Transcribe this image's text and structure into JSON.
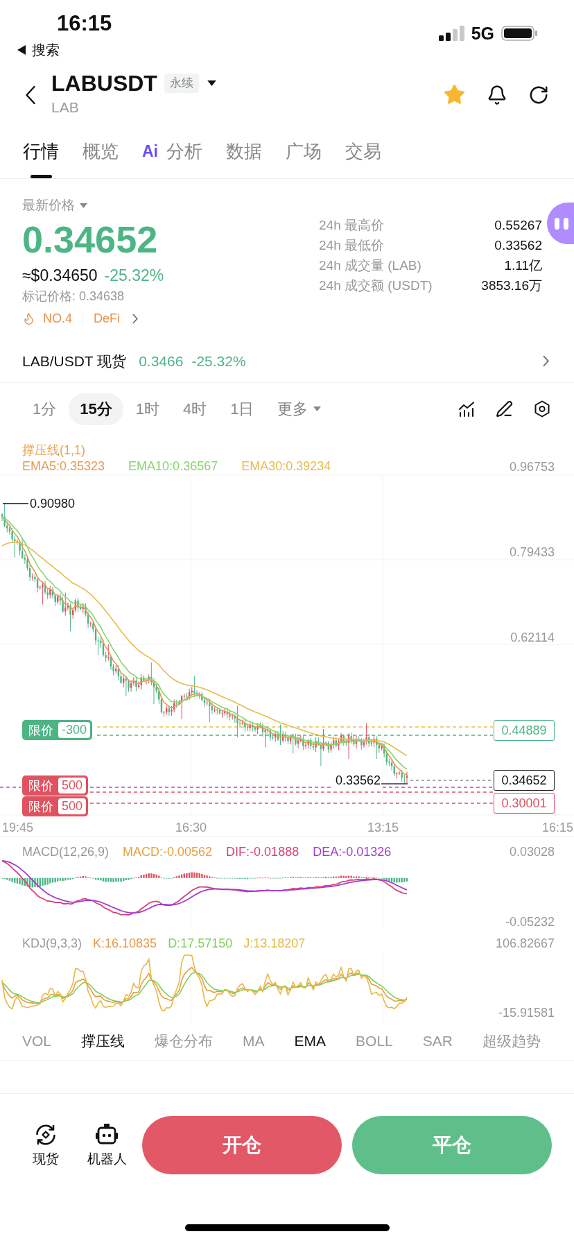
{
  "status_bar": {
    "time": "16:15",
    "back_app": "搜索",
    "network": "5G"
  },
  "header": {
    "symbol": "LABUSDT",
    "badge": "永续",
    "subtitle": "LAB",
    "favorite": true
  },
  "tabs": [
    {
      "label": "行情",
      "selected": true
    },
    {
      "label": "概览",
      "selected": false
    },
    {
      "label": "分析",
      "prefix": "Ai",
      "selected": false
    },
    {
      "label": "数据",
      "selected": false
    },
    {
      "label": "广场",
      "selected": false
    },
    {
      "label": "交易",
      "selected": false
    }
  ],
  "price": {
    "label": "最新价格",
    "last": "0.34652",
    "usd": "≈$0.34650",
    "change": "-25.32%",
    "mark_price": "标记价格: 0.34638",
    "rank": "NO.4",
    "sector": "DeFi"
  },
  "stats": [
    {
      "label": "24h 最高价",
      "value": "0.55267"
    },
    {
      "label": "24h 最低价",
      "value": "0.33562"
    },
    {
      "label": "24h 成交量 (LAB)",
      "value": "1.11亿"
    },
    {
      "label": "24h 成交额 (USDT)",
      "value": "3853.16万"
    }
  ],
  "spot": {
    "pair": "LAB/USDT 现货",
    "price": "0.3466",
    "change": "-25.32%"
  },
  "intervals": [
    {
      "label": "1分",
      "kind": "option",
      "selected": false
    },
    {
      "label": "15分",
      "kind": "option",
      "selected": true
    },
    {
      "label": "1时",
      "kind": "option",
      "selected": false
    },
    {
      "label": "4时",
      "kind": "option",
      "selected": false
    },
    {
      "label": "1日",
      "kind": "option",
      "selected": false
    },
    {
      "label": "更多",
      "kind": "menu",
      "selected": false
    }
  ],
  "chart": {
    "legend_title": "撑压线(1,1)",
    "ema": [
      {
        "label": "EMA5:0.35323",
        "color": "#e59a52"
      },
      {
        "label": "EMA10:0.36567",
        "color": "#86d66c"
      },
      {
        "label": "EMA30:0.39234",
        "color": "#e8bb4c"
      }
    ],
    "y_labels": [
      "0.96753",
      "0.79433",
      "0.62114"
    ],
    "high_label": "0.90980",
    "low_label": "0.33562",
    "orders": [
      {
        "type": "限价",
        "qty": "-300",
        "kind": "buy"
      },
      {
        "type": "限价",
        "qty": "500",
        "kind": "sell"
      },
      {
        "type": "限价",
        "qty": "500",
        "kind": "sell"
      }
    ],
    "price_tags": [
      {
        "value": "0.44889",
        "kind": "order_buy"
      },
      {
        "value": "0.34652",
        "kind": "last"
      },
      {
        "value": "0.30001",
        "kind": "order_sell"
      }
    ],
    "x_labels": [
      "19:45",
      "16:30",
      "13:15",
      "16:15"
    ]
  },
  "macd": {
    "title": "MACD(12,26,9)",
    "values": [
      {
        "label": "MACD:-0.00562",
        "color": "#e8a040"
      },
      {
        "label": "DIF:-0.01888",
        "color": "#d8407a"
      },
      {
        "label": "DEA:-0.01326",
        "color": "#a03ed0"
      }
    ],
    "max": "0.03028",
    "min": "-0.05232"
  },
  "kdj": {
    "title": "KDJ(9,3,3)",
    "values": [
      {
        "label": "K:16.10835",
        "color": "#e89a4a"
      },
      {
        "label": "D:17.57150",
        "color": "#7dd058"
      },
      {
        "label": "J:13.18207",
        "color": "#e8b840"
      }
    ],
    "max": "106.82667",
    "min": "-15.91581"
  },
  "indicators": [
    {
      "label": "VOL",
      "selected": false
    },
    {
      "label": "撑压线",
      "selected": true
    },
    {
      "label": "爆仓分布",
      "selected": false
    },
    {
      "label": "MA",
      "selected": false
    },
    {
      "label": "EMA",
      "selected": true
    },
    {
      "label": "BOLL",
      "selected": false
    },
    {
      "label": "SAR",
      "selected": false
    },
    {
      "label": "超级趋势",
      "selected": false
    }
  ],
  "bottom_bar": {
    "shortcuts": [
      {
        "label": "现货",
        "kind": "spot"
      },
      {
        "label": "机器人",
        "kind": "bot"
      }
    ],
    "actions": [
      {
        "label": "开仓",
        "kind": "open"
      },
      {
        "label": "平仓",
        "kind": "close"
      }
    ]
  }
}
